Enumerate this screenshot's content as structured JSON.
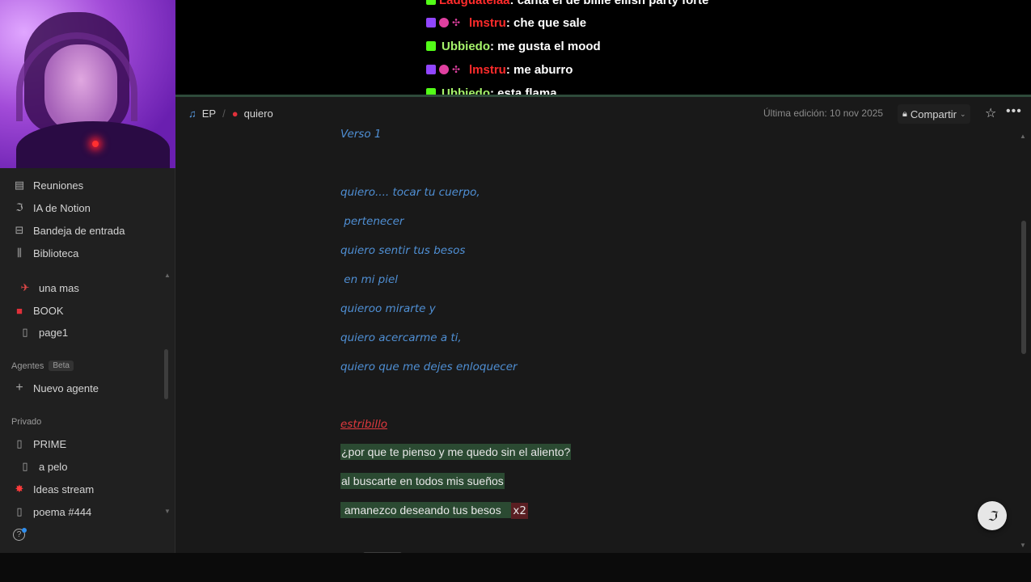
{
  "chat": {
    "messages": [
      {
        "user": "Ladguatelaa",
        "text": ": canta el de billie eilish party forte",
        "user_color": "#ff2b2b",
        "badges": [
          "kick"
        ]
      },
      {
        "user": "lmstru",
        "text": ": che que sale",
        "user_color": "#ff2b2b",
        "badges": [
          "twitch",
          "heart",
          "dots"
        ]
      },
      {
        "user": "Ubbiedo",
        "text": ": me gusta el mood",
        "user_color": "#a6f36b",
        "badges": [
          "kick"
        ]
      },
      {
        "user": "lmstru",
        "text": ": me aburro",
        "user_color": "#ff2b2b",
        "badges": [
          "twitch",
          "heart",
          "dots"
        ]
      },
      {
        "user": "Ubbiedo",
        "text": ": esta flama",
        "user_color": "#a6f36b",
        "badges": [
          "kick"
        ]
      }
    ]
  },
  "sidebar": {
    "top_items": [
      {
        "label": "Reuniones",
        "icon": "meeting-notes-icon"
      },
      {
        "label": "IA de Notion",
        "icon": "notion-ai-icon"
      },
      {
        "label": "Bandeja de entrada",
        "icon": "inbox-icon"
      },
      {
        "label": "Biblioteca",
        "icon": "library-icon"
      }
    ],
    "pages": [
      {
        "label": "una mas",
        "icon": "rocket-icon"
      },
      {
        "label": "BOOK",
        "icon": "red-book-icon"
      },
      {
        "label": "page1",
        "icon": "page-icon"
      }
    ],
    "agents_section": "Agentes",
    "agents_badge": "Beta",
    "new_agent": "Nuevo agente",
    "private_section": "Privado",
    "private_pages": [
      {
        "label": "PRIME",
        "icon": "page-icon"
      },
      {
        "label": "a pelo",
        "icon": "page-icon"
      },
      {
        "label": "Ideas stream",
        "icon": "sparkle-icon"
      },
      {
        "label": "poema #444",
        "icon": "page-icon"
      }
    ]
  },
  "topbar": {
    "crumb_parent": "EP",
    "crumb_page": "quiero",
    "edited": "Última edición: 10 nov 2025",
    "share": "Compartir"
  },
  "doc": {
    "verse_title": "Verso 1",
    "verse_lines": [
      "quiero.... tocar tu cuerpo,",
      " pertenecer",
      "quiero sentir tus besos",
      " en mi piel",
      "quieroo mirarte y",
      "quiero acercarme a ti,",
      "quiero que me dejes enloquecer"
    ],
    "chorus_title": "estribillo",
    "chorus_lines": [
      "¿por que te pienso y me quedo sin el aliento?",
      "al buscarte en todos mis sueños",
      " amanezco deseando tus besos   "
    ],
    "chorus_repeat": "x2"
  },
  "colors": {
    "verse_text": "#4f8fd4",
    "chorus_title": "#e0393e",
    "highlight_green": "#2b4a32",
    "highlight_red": "#5a1e22"
  }
}
